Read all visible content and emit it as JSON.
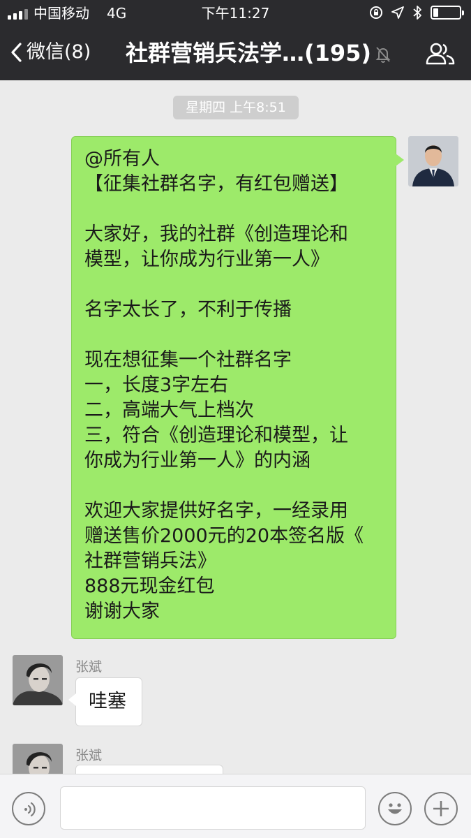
{
  "status_bar": {
    "carrier": "中国移动",
    "network": "4G",
    "time": "下午11:27",
    "battery_level": 0.2
  },
  "nav": {
    "back_label": "微信(8)",
    "title": "社群营销兵法学…(195)",
    "icons": [
      "chevron-left-icon",
      "mute-bell-icon",
      "group-members-icon"
    ]
  },
  "chat": {
    "timestamp": "星期四 上午8:51",
    "messages": [
      {
        "direction": "outgoing",
        "lines": [
          "@所有人",
          "【征集社群名字，有红包赠送】",
          "",
          "大家好，我的社群《创造理论和",
          "模型，让你成为行业第一人》",
          "",
          "名字太长了，不利于传播",
          "",
          "现在想征集一个社群名字",
          "一，长度3字左右",
          "二，高端大气上档次",
          "三，符合《创造理论和模型，让",
          "你成为行业第一人》的内涵",
          "",
          "欢迎大家提供好名字，一经录用",
          "赠送售价2000元的20本签名版《",
          "社群营销兵法》",
          "888元现金红包",
          "谢谢大家"
        ]
      },
      {
        "direction": "incoming",
        "sender": "张斌",
        "text": "哇塞"
      },
      {
        "direction": "incoming",
        "sender": "张斌",
        "text": ""
      }
    ]
  },
  "input_bar": {
    "icons": [
      "voice-icon",
      "emoji-icon",
      "plus-icon"
    ],
    "text_value": ""
  },
  "colors": {
    "header_bg": "#2b2b2e",
    "chat_bg": "#ebebeb",
    "outgoing_bubble": "#9dea6a",
    "incoming_bubble": "#ffffff",
    "timestamp_bg": "#cecece"
  }
}
